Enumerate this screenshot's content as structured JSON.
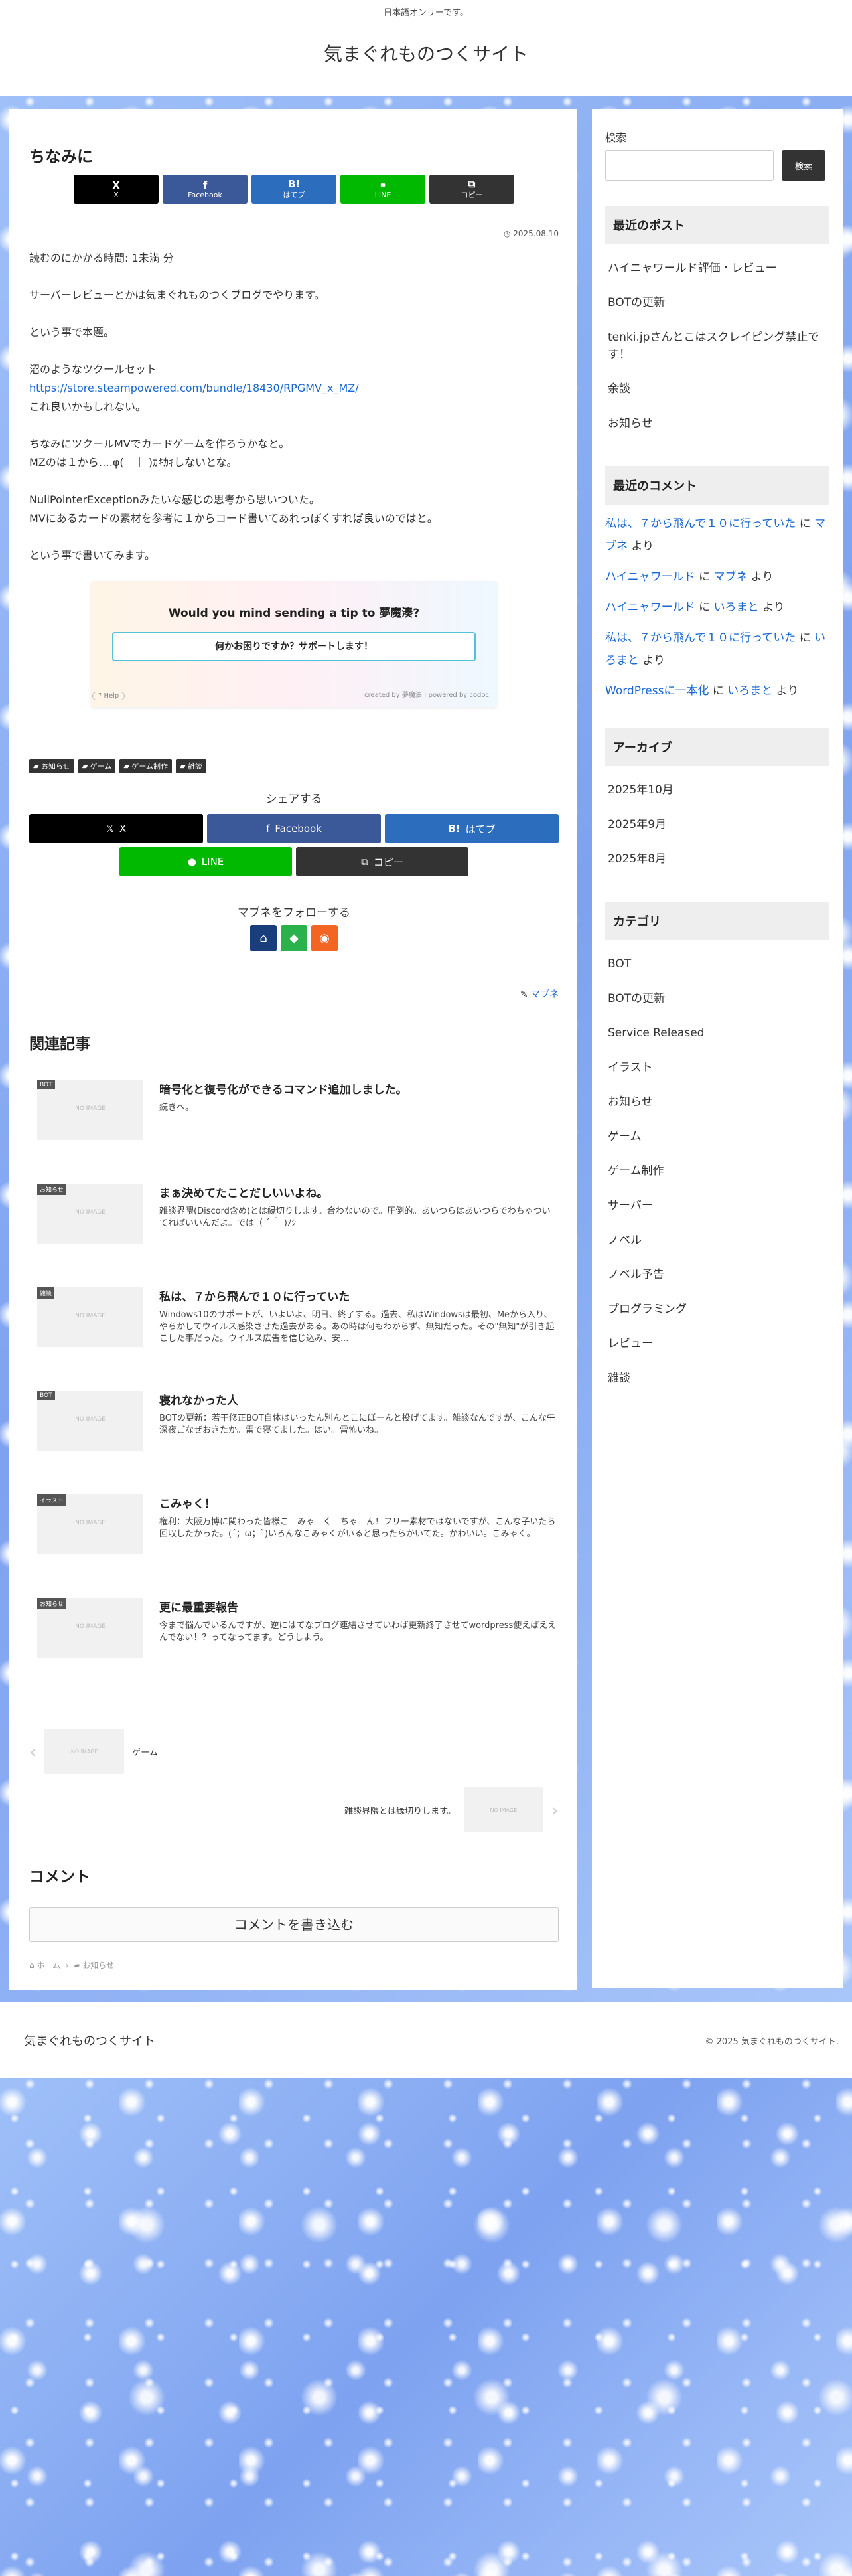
{
  "header": {
    "notice": "日本語オンリーです。",
    "site_title": "気まぐれものつくサイト"
  },
  "article": {
    "title": "ちなみに",
    "share_top": [
      {
        "icon": "X",
        "label": "X"
      },
      {
        "icon": "f",
        "label": "Facebook"
      },
      {
        "icon": "B!",
        "label": "はてブ"
      },
      {
        "icon": "LINE",
        "label": "LINE"
      },
      {
        "icon": "copy",
        "label": "コピー"
      }
    ],
    "date": "2025.08.10",
    "reading_time": "読むのにかかる時間: 1未満 分",
    "paragraphs": [
      "サーバーレビューとかは気まぐれものつくブログでやります。",
      "という事で本題。"
    ],
    "tool_intro": "沼のようなツクールセット",
    "tool_link": "https://store.steampowered.com/bundle/18430/RPGMV_x_MZ/",
    "tool_after": "これ良いかもしれない。",
    "card_game_1": "ちなみにツクールMVでカードゲームを作ろうかなと。",
    "card_game_2": "MZのは１から….φ(｜｜ )ｶｷｶｷしないとな。",
    "npe_1": "NullPointerExceptionみたいな感じの思考から思いついた。",
    "npe_2": "MVにあるカードの素材を参考に１からコード書いてあれっぽくすれば良いのではと。",
    "closing": "という事で書いてみます。",
    "tip": {
      "title": "Would you mind sending a tip to 夢魔湊?",
      "button": "何かお困りですか？サポートします！",
      "help": "? Help",
      "credit": "created by 夢魔湊  |  powered by codoc"
    },
    "categories": [
      "お知らせ",
      "ゲーム",
      "ゲーム制作",
      "雑談"
    ],
    "share_label": "シェアする",
    "share_bottom": [
      "X",
      "Facebook",
      "はてブ",
      "LINE",
      "コピー"
    ],
    "follow_label": "マブネをフォローする",
    "author": "マブネ"
  },
  "related": {
    "title": "関連記事",
    "items": [
      {
        "tag": "BOT",
        "thumb": "NO IMAGE",
        "title": "暗号化と復号化ができるコマンド追加しました。",
        "snippet": "続きへ。"
      },
      {
        "tag": "お知らせ",
        "thumb": "NO IMAGE",
        "title": "まぁ決めてたことだしいいよね。",
        "snippet": "雑談界隈(Discord含め)とは縁切りします。合わないので。圧倒的。あいつらはあいつらでわちゃついてればいいんだよ。では（ ´ ｀ )ﾉｼ"
      },
      {
        "tag": "雑談",
        "thumb": "NO IMAGE",
        "title": "私は、７から飛んで１０に行っていた",
        "snippet": "Windows10のサポートが、いよいよ、明日、終了する。過去、私はWindowsは最初、Meから入り、やらかしてウイルス感染させた過去がある。あの時は何もわからず、無知だった。その\"無知\"が引き起こした事だった。ウイルス広告を信じ込み、安..."
      },
      {
        "tag": "BOT",
        "thumb": "NO IMAGE",
        "title": "寝れなかった人",
        "snippet": "BOTの更新：若干修正BOT自体はいったん別んとこにぽーんと投げてます。雑談なんですが、こんな午深夜ごなぜおきたか。雷で寝てました。はい。雷怖いね。"
      },
      {
        "tag": "イラスト",
        "thumb": "NO IMAGE",
        "title": "こみゃく！",
        "snippet": "権利：大阪万博に関わった皆様こ　みゃ　く　ちゃ　ん！フリー素材ではないですが、こんな子いたら回収したかった。(´；ω；`)いろんなこみゃくがいると思ったらかいてた。かわいい。こみゃく。"
      },
      {
        "tag": "お知らせ",
        "thumb": "NO IMAGE",
        "title": "更に最重要報告",
        "snippet": "今まで悩んでいるんですが、逆にはてなブログ連結させていわば更新終了させてwordpress使えばええんでない！？ってなってます。どうしよう。"
      }
    ]
  },
  "pager": {
    "prev_thumb": "NO IMAGE",
    "prev_title": "ゲーム",
    "next_thumb": "NO IMAGE",
    "next_title": "雑談界隈とは縁切りします。"
  },
  "comments": {
    "title": "コメント",
    "button": "コメントを書き込む"
  },
  "breadcrumb": {
    "home": "ホーム",
    "category": "お知らせ"
  },
  "sidebar": {
    "search_label": "検索",
    "search_button": "検索",
    "recent_posts_title": "最近のポスト",
    "recent_posts": [
      "ハイニャワールド評価・レビュー",
      "BOTの更新",
      "tenki.jpさんとこはスクレイピング禁止です！",
      "余談",
      "お知らせ"
    ],
    "recent_comments_title": "最近のコメント",
    "recent_comments": [
      {
        "post": "私は、７から飛んで１０に行っていた",
        "sep": " に ",
        "author": "マブネ",
        "suffix": " より"
      },
      {
        "post": "ハイニャワールド",
        "sep": " に ",
        "author": "マブネ",
        "suffix": " より"
      },
      {
        "post": "ハイニャワールド",
        "sep": " に ",
        "author": "いろまと",
        "suffix": " より"
      },
      {
        "post": "私は、７から飛んで１０に行っていた",
        "sep": " に ",
        "author": "いろまと",
        "suffix": " より"
      },
      {
        "post": "WordPressに一本化",
        "sep": " に ",
        "author": "いろまと",
        "suffix": " より"
      }
    ],
    "archive_title": "アーカイブ",
    "archives": [
      "2025年10月",
      "2025年9月",
      "2025年8月"
    ],
    "category_title": "カテゴリ",
    "categories": [
      "BOT",
      "BOTの更新",
      "Service Released",
      "イラスト",
      "お知らせ",
      "ゲーム",
      "ゲーム制作",
      "サーバー",
      "ノベル",
      "ノベル予告",
      "プログラミング",
      "レビュー",
      "雑談"
    ]
  },
  "footer": {
    "site_name": "気まぐれものつくサイト",
    "copyright": "© 2025 気まぐれものつくサイト."
  },
  "colors": {
    "x": "#000000",
    "facebook": "#3b5998",
    "hatena": "#2c6ebd",
    "line": "#00b900",
    "copy": "#333333",
    "link": "#1967d2"
  }
}
